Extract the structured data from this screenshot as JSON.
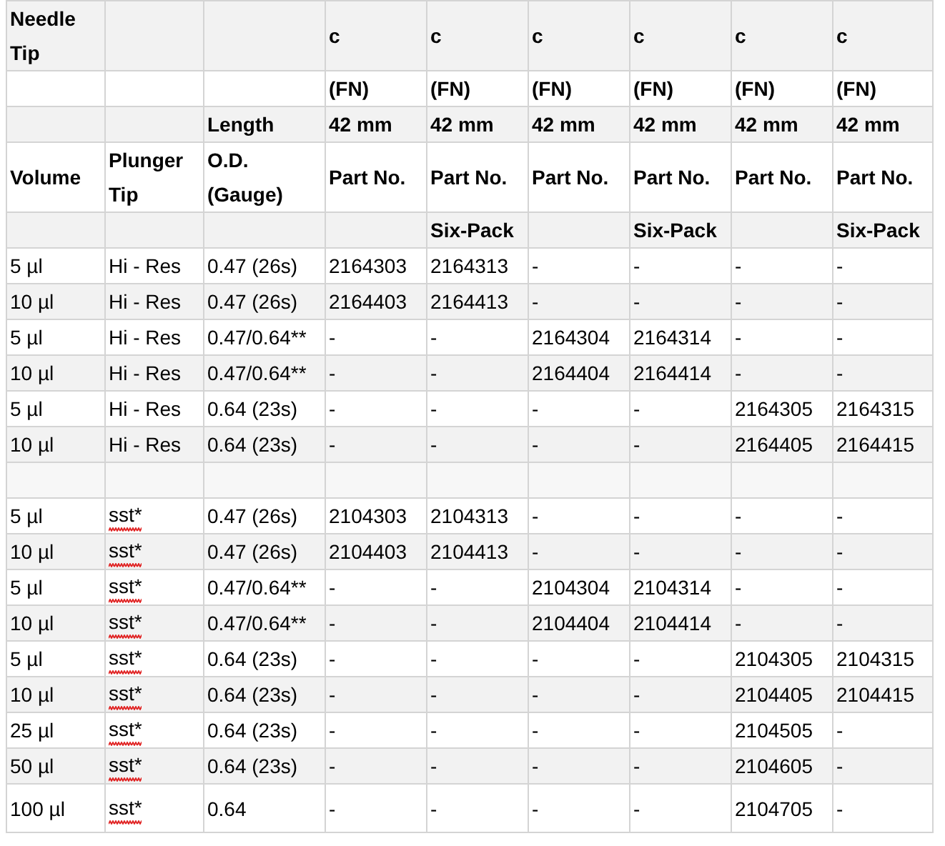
{
  "table": {
    "header_rows": [
      [
        "Needle Tip",
        "",
        "",
        "c",
        "c",
        "c",
        "c",
        "c",
        "c"
      ],
      [
        "",
        "",
        "",
        "(FN)",
        "(FN)",
        "(FN)",
        "(FN)",
        "(FN)",
        "(FN)"
      ],
      [
        "",
        "",
        "Length",
        "42 mm",
        "42 mm",
        "42 mm",
        "42 mm",
        "42 mm",
        "42 mm"
      ],
      [
        "Volume",
        "Plunger Tip",
        "O.D. (Gauge)",
        "Part No.",
        "Part No.",
        "Part No.",
        "Part No.",
        "Part No.",
        "Part No."
      ],
      [
        "",
        "",
        "",
        "",
        "Six-Pack",
        "",
        "Six-Pack",
        "",
        "Six-Pack"
      ]
    ],
    "sections": [
      {
        "rows": [
          {
            "cells": [
              " 5 µl",
              "Hi - Res",
              "0.47 (26s)",
              "2164303",
              "2164313",
              "-",
              "-",
              "-",
              "-"
            ],
            "spell_error": false
          },
          {
            "cells": [
              "10 µl",
              "Hi - Res",
              "0.47 (26s)",
              "2164403",
              "2164413",
              "-",
              "-",
              "-",
              "-"
            ],
            "spell_error": false
          },
          {
            "cells": [
              "5 µl",
              "Hi - Res",
              "0.47/0.64**",
              "-",
              "-",
              "2164304",
              "2164314",
              "-",
              "-"
            ],
            "spell_error": false
          },
          {
            "cells": [
              "10 µl",
              "Hi - Res",
              "0.47/0.64**",
              "-",
              "-",
              "2164404",
              "2164414",
              "-",
              "-"
            ],
            "spell_error": false
          },
          {
            "cells": [
              "5 µl",
              "Hi - Res",
              "0.64 (23s)",
              "-",
              "-",
              "-",
              "-",
              "2164305",
              "2164315"
            ],
            "spell_error": false
          },
          {
            "cells": [
              "10 µl",
              "Hi - Res",
              "0.64 (23s)",
              "-",
              "-",
              "-",
              "-",
              "2164405",
              "2164415"
            ],
            "spell_error": false
          }
        ]
      },
      {
        "rows": [
          {
            "cells": [
              "5 µl",
              "sst*",
              "0.47 (26s)",
              "2104303",
              "2104313",
              "-",
              "-",
              "-",
              "-"
            ],
            "spell_error": true
          },
          {
            "cells": [
              "10 µl",
              "sst*",
              "0.47 (26s)",
              "2104403",
              "2104413",
              "-",
              "-",
              "-",
              "-"
            ],
            "spell_error": true
          },
          {
            "cells": [
              "5 µl",
              "sst*",
              "0.47/0.64**",
              "-",
              "-",
              "2104304",
              "2104314",
              "-",
              "-"
            ],
            "spell_error": true
          },
          {
            "cells": [
              "10 µl",
              "sst*",
              "0.47/0.64**",
              "-",
              "-",
              "2104404",
              "2104414",
              "-",
              "-"
            ],
            "spell_error": true
          },
          {
            "cells": [
              "5 µl",
              "sst*",
              "0.64 (23s)",
              "-",
              "-",
              "-",
              "-",
              "2104305",
              "2104315"
            ],
            "spell_error": true
          },
          {
            "cells": [
              "10 µl",
              "sst*",
              "0.64 (23s)",
              "-",
              "-",
              "-",
              "-",
              "2104405",
              "2104415"
            ],
            "spell_error": true
          },
          {
            "cells": [
              "25 µl",
              "sst*",
              "0.64 (23s)",
              "-",
              "-",
              "-",
              "-",
              "2104505",
              "-"
            ],
            "spell_error": true
          },
          {
            "cells": [
              "50 µl",
              "sst*",
              "0.64 (23s)",
              "-",
              "-",
              "-",
              "-",
              "2104605",
              "-"
            ],
            "spell_error": true
          },
          {
            "cells": [
              "100 µl",
              "sst*",
              "0.64",
              "-",
              "-",
              "-",
              "-",
              "2104705",
              "-"
            ],
            "spell_error": true
          }
        ]
      }
    ]
  }
}
